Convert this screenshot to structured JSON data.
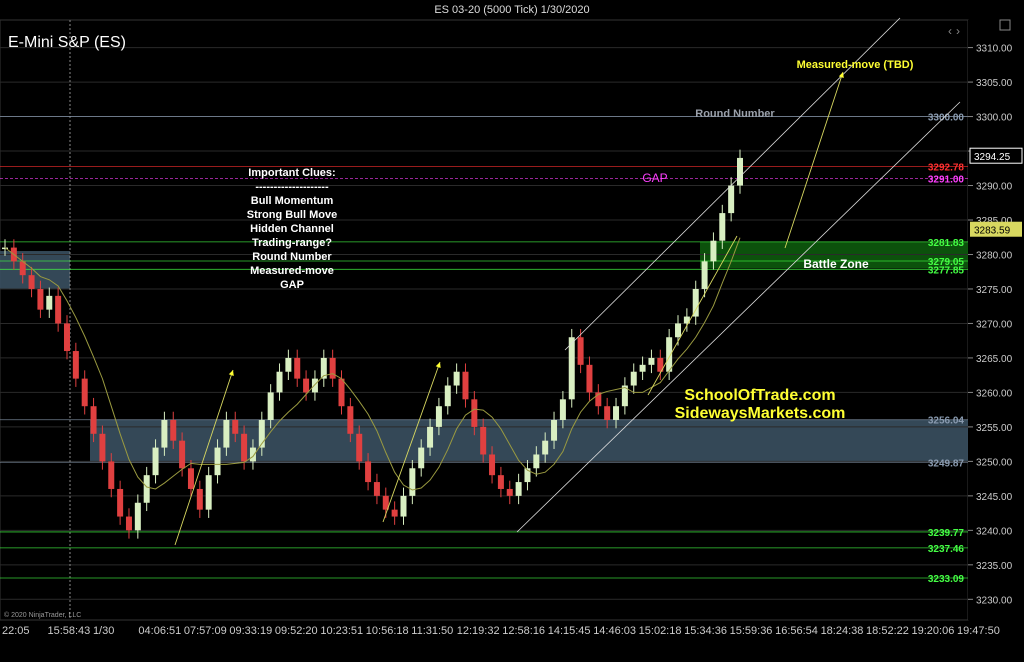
{
  "window": {
    "title": "ES 03-20 (5000 Tick)  1/30/2020"
  },
  "chart_data": {
    "type": "candlestick",
    "instrument": "E-Mini S&P (ES)",
    "ylim": [
      3227,
      3314
    ],
    "y_ticks": [
      3230,
      3235,
      3240,
      3245,
      3250,
      3255,
      3260,
      3265,
      3270,
      3275,
      3280,
      3285,
      3290,
      3295,
      3300,
      3305,
      3310
    ],
    "y_tick_labels": [
      "3230.00",
      "3235.00",
      "3240.00",
      "3245.00",
      "3250.00",
      "3255.00",
      "3260.00",
      "3265.00",
      "3270.00",
      "3275.00",
      "3280.00",
      "3285.00",
      "3290.00",
      "3295.00",
      "3300.00",
      "3305.00",
      "3310.00"
    ],
    "x_tick_labels": [
      "22:05",
      "15:58:43",
      "1/30",
      "04:06:51",
      "07:57:09",
      "09:33:19",
      "09:52:20",
      "10:23:51",
      "10:56:18",
      "11:31:50",
      "12:19:32",
      "12:58:16",
      "14:15:45",
      "14:46:03",
      "15:02:18",
      "15:34:36",
      "15:59:36",
      "16:56:54",
      "18:24:38",
      "18:52:22",
      "19:20:06",
      "19:47:50"
    ],
    "ohlc_path": [
      3281,
      3279,
      3277,
      3275,
      3272,
      3274,
      3270,
      3266,
      3262,
      3258,
      3254,
      3250,
      3246,
      3242,
      3240,
      3244,
      3248,
      3252,
      3256,
      3253,
      3249,
      3246,
      3243,
      3248,
      3252,
      3256,
      3254,
      3250,
      3252,
      3256,
      3260,
      3263,
      3265,
      3262,
      3260,
      3262,
      3265,
      3262,
      3258,
      3254,
      3250,
      3247,
      3245,
      3243,
      3242,
      3245,
      3249,
      3252,
      3255,
      3258,
      3261,
      3263,
      3259,
      3255,
      3251,
      3248,
      3246,
      3245,
      3247,
      3249,
      3251,
      3253,
      3256,
      3259,
      3268,
      3264,
      3260,
      3258,
      3256,
      3258,
      3261,
      3263,
      3264,
      3265,
      3263,
      3268,
      3270,
      3271,
      3275,
      3279,
      3282,
      3286,
      3290,
      3294
    ],
    "price_lines": [
      {
        "value": 3300.0,
        "label": "3300.00",
        "color": "#8a9bb0"
      },
      {
        "value": 3292.78,
        "label": "3292.78",
        "color": "#ff3030"
      },
      {
        "value": 3291.0,
        "label": "3291.00",
        "color": "#ff40ff"
      },
      {
        "value": 3281.83,
        "label": "3281.83",
        "color": "#44ff44"
      },
      {
        "value": 3279.05,
        "label": "3279.05",
        "color": "#44ff44"
      },
      {
        "value": 3277.85,
        "label": "3277.85",
        "color": "#44ff44"
      },
      {
        "value": 3256.04,
        "label": "3256.04",
        "color": "#8a9bb0"
      },
      {
        "value": 3249.87,
        "label": "3249.87",
        "color": "#8a9bb0"
      },
      {
        "value": 3239.77,
        "label": "3239.77",
        "color": "#44ff44"
      },
      {
        "value": 3237.46,
        "label": "3237.46",
        "color": "#44ff44"
      },
      {
        "value": 3233.09,
        "label": "3233.09",
        "color": "#44ff44"
      }
    ],
    "current_price": {
      "value": 3294.25,
      "label": "3294.25"
    },
    "cursor_price": {
      "value": 3283.59,
      "label": "3283.59"
    },
    "zones": [
      {
        "name": "Battle Zone",
        "low": 3278.0,
        "high": 3281.83,
        "color": "#0d5a0d"
      },
      {
        "name": "",
        "low": 3249.87,
        "high": 3256.04,
        "color": "#3a5060"
      }
    ],
    "annotations": {
      "clues_title": "Important Clues:",
      "clues_divider": "--------------------",
      "clues": [
        "Bull Momentum",
        "Strong Bull Move",
        "Hidden Channel",
        "Trading-range?",
        "Round Number",
        "Measured-move",
        "GAP"
      ],
      "round_number": "Round Number",
      "gap": "GAP",
      "measured_move": "Measured-move (TBD)",
      "battle_zone": "Battle Zone",
      "watermark_1": "SchoolOfTrade.com",
      "watermark_2": "SidewaysMarkets.com",
      "copyright": "© 2020 NinjaTrader, LLC"
    },
    "colors": {
      "bull": "#d9efc2",
      "bear": "#e04040",
      "ma": "#9a9a40",
      "grid": "#2a2a2a",
      "annotation_yellow": "#ffff33"
    }
  }
}
